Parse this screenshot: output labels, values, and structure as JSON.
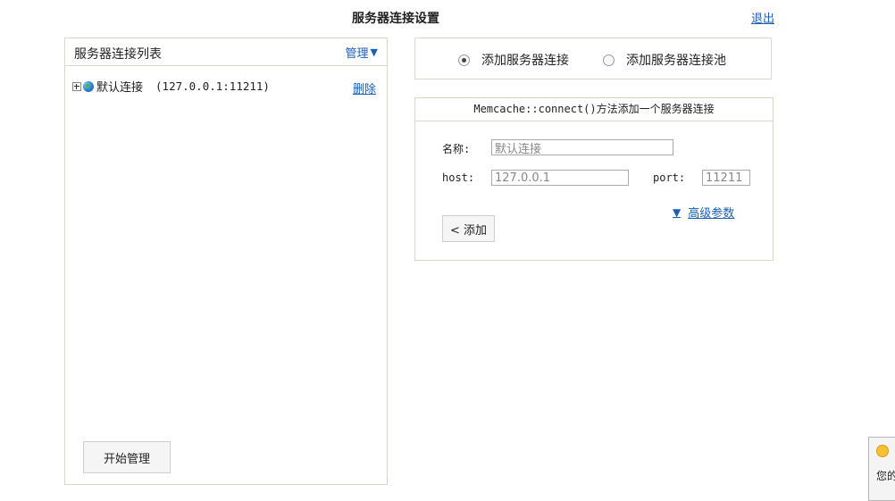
{
  "header": {
    "title": "服务器连接设置",
    "logout_label": "退出"
  },
  "left_panel": {
    "title": "服务器连接列表",
    "manage_label": "管理",
    "connections": [
      {
        "name": "默认连接",
        "address": "(127.0.0.1:11211)",
        "delete_label": "删除"
      }
    ],
    "start_button_label": "开始管理"
  },
  "radio_options": [
    {
      "label": "添加服务器连接",
      "checked": true
    },
    {
      "label": "添加服务器连接池",
      "checked": false
    }
  ],
  "form": {
    "header": "Memcache::connect()方法添加一个服务器连接",
    "name_label": "名称:",
    "name_value": "默认连接",
    "host_label": "host:",
    "host_value": "127.0.0.1",
    "port_label": "port:",
    "port_value": "11211",
    "advanced_label": "高级参数",
    "add_button_label": "< 添加"
  },
  "popup": {
    "text": "您的"
  }
}
